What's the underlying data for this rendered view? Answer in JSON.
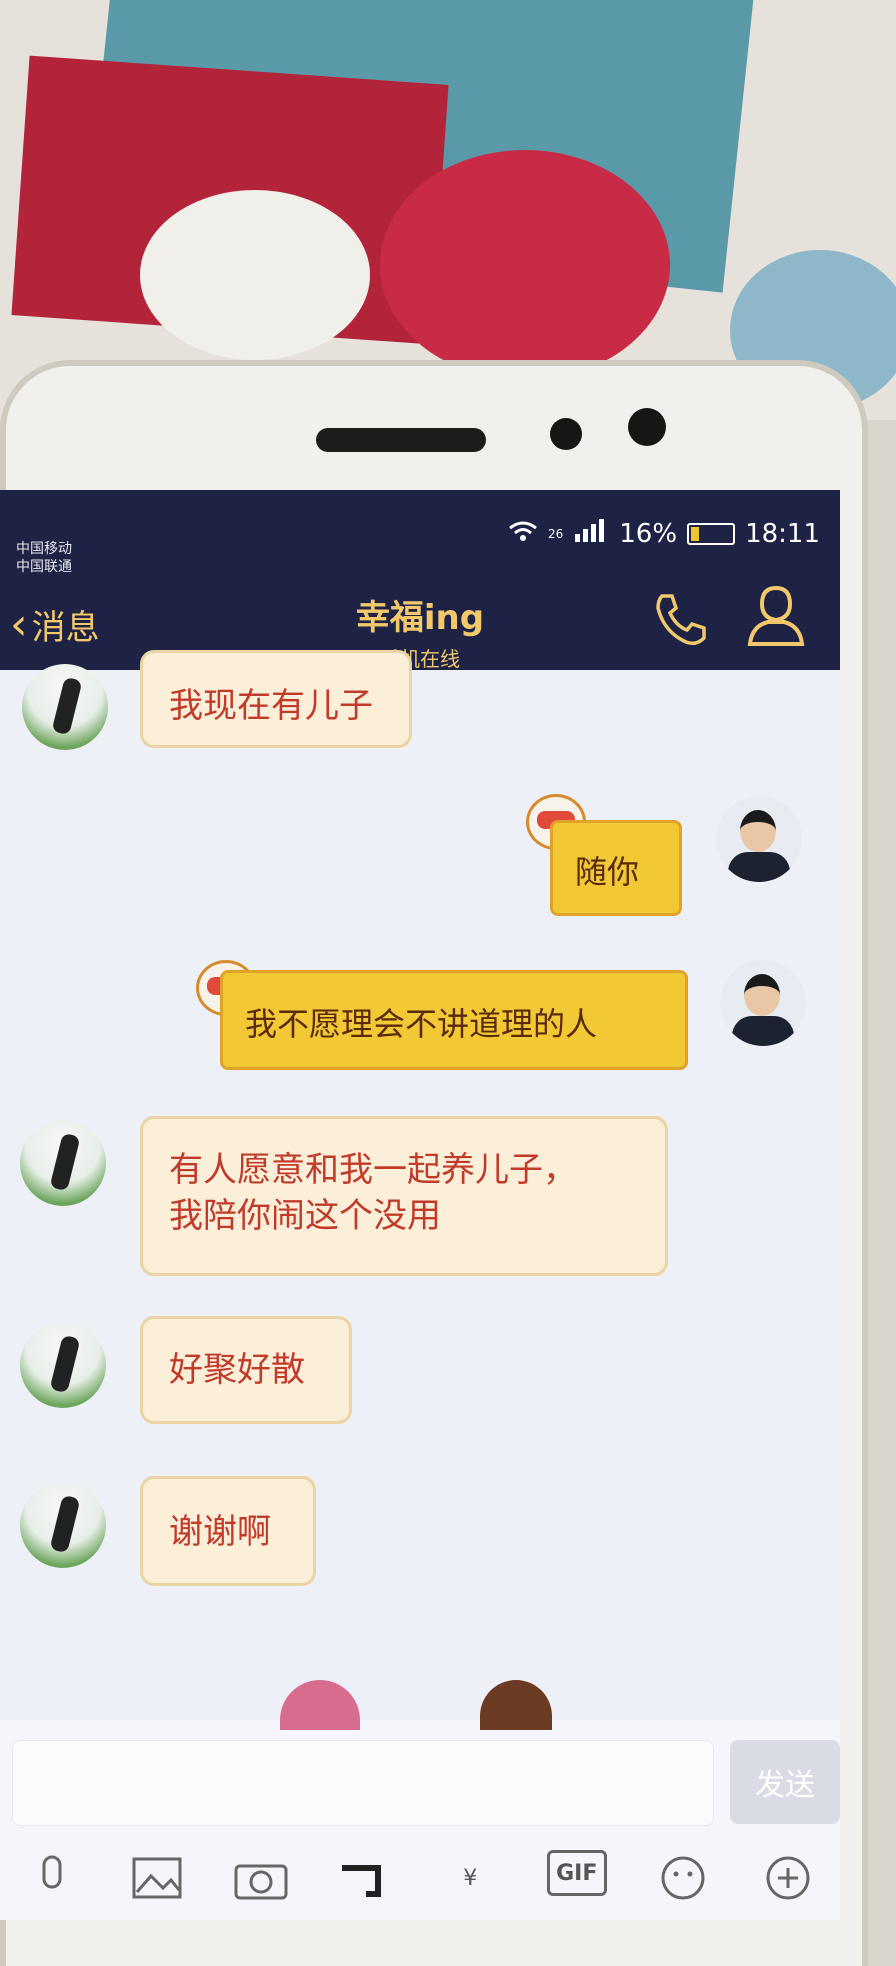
{
  "status_bar": {
    "carrier1": "中国移动",
    "carrier2": "中国联通",
    "net": "26",
    "battery": "16%",
    "time": "18:11"
  },
  "header": {
    "back_label": "消息",
    "title": "幸福ing",
    "subtitle": "手机在线"
  },
  "messages": [
    {
      "from": "peer",
      "text": "我现在有儿子"
    },
    {
      "from": "me",
      "text": "随你"
    },
    {
      "from": "me",
      "text": "我不愿理会不讲道理的人"
    },
    {
      "from": "peer",
      "text": "有人愿意和我一起养儿子，"
    },
    {
      "from": "peer",
      "text": "我陪你闹这个没用"
    },
    {
      "from": "peer",
      "text": "好聚好散"
    },
    {
      "from": "peer",
      "text": "谢谢啊"
    }
  ],
  "input": {
    "send_label": "发送"
  },
  "toolbar": {
    "gif_label": "GIF",
    "yuan": "¥"
  },
  "icons": [
    "phone-icon",
    "profile-icon",
    "mic-icon",
    "image-icon",
    "camera-icon",
    "hongbao-icon",
    "gif-icon",
    "emoji-icon",
    "plus-icon"
  ]
}
